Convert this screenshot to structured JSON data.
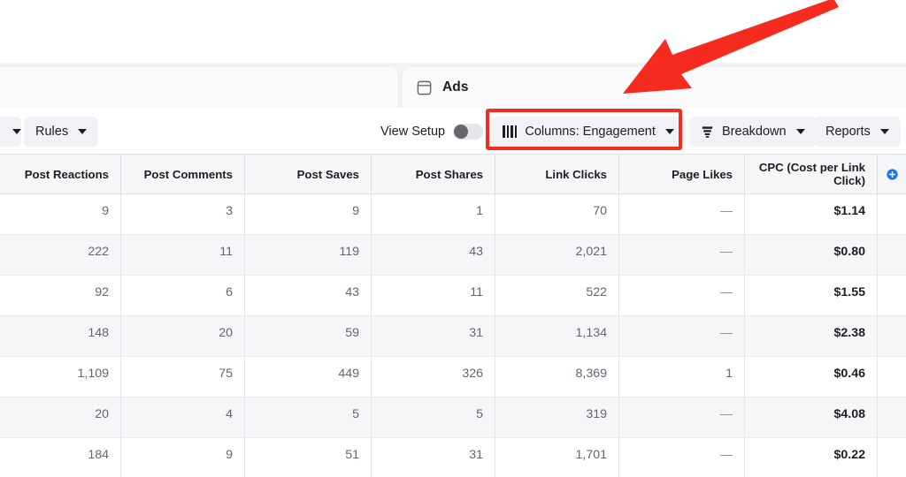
{
  "tabs": {
    "ads": {
      "label": "Ads",
      "icon": "ads-window-icon"
    }
  },
  "toolbar": {
    "rules": {
      "label": "Rules",
      "icon": "chevron-down-icon"
    },
    "view_setup": {
      "label": "View Setup",
      "toggle_state": "off"
    },
    "columns": {
      "label": "Columns: Engagement",
      "icon": "columns-icon"
    },
    "breakdown": {
      "label": "Breakdown",
      "icon": "breakdown-icon"
    },
    "reports": {
      "label": "Reports",
      "icon": "chevron-down-icon"
    }
  },
  "annotation": {
    "highlight_color": "#f62b1f",
    "arrow_color": "#f62b1f",
    "target": "Columns: Engagement"
  },
  "table": {
    "columns": [
      "Post Reactions",
      "Post Comments",
      "Post Saves",
      "Post Shares",
      "Link Clicks",
      "Page Likes",
      "CPC (Cost per Link Click)"
    ],
    "add_column_icon": "add-column-icon",
    "rows": [
      {
        "post_reactions": "9",
        "post_comments": "3",
        "post_saves": "9",
        "post_shares": "1",
        "link_clicks": "70",
        "page_likes": "—",
        "cpc": "$1.14"
      },
      {
        "post_reactions": "222",
        "post_comments": "11",
        "post_saves": "119",
        "post_shares": "43",
        "link_clicks": "2,021",
        "page_likes": "—",
        "cpc": "$0.80"
      },
      {
        "post_reactions": "92",
        "post_comments": "6",
        "post_saves": "43",
        "post_shares": "11",
        "link_clicks": "522",
        "page_likes": "—",
        "cpc": "$1.55"
      },
      {
        "post_reactions": "148",
        "post_comments": "20",
        "post_saves": "59",
        "post_shares": "31",
        "link_clicks": "1,134",
        "page_likes": "—",
        "cpc": "$2.38"
      },
      {
        "post_reactions": "1,109",
        "post_comments": "75",
        "post_saves": "449",
        "post_shares": "326",
        "link_clicks": "8,369",
        "page_likes": "1",
        "cpc": "$0.46"
      },
      {
        "post_reactions": "20",
        "post_comments": "4",
        "post_saves": "5",
        "post_shares": "5",
        "link_clicks": "319",
        "page_likes": "—",
        "cpc": "$4.08"
      },
      {
        "post_reactions": "184",
        "post_comments": "9",
        "post_saves": "51",
        "post_shares": "31",
        "link_clicks": "1,701",
        "page_likes": "—",
        "cpc": "$0.22"
      }
    ]
  }
}
